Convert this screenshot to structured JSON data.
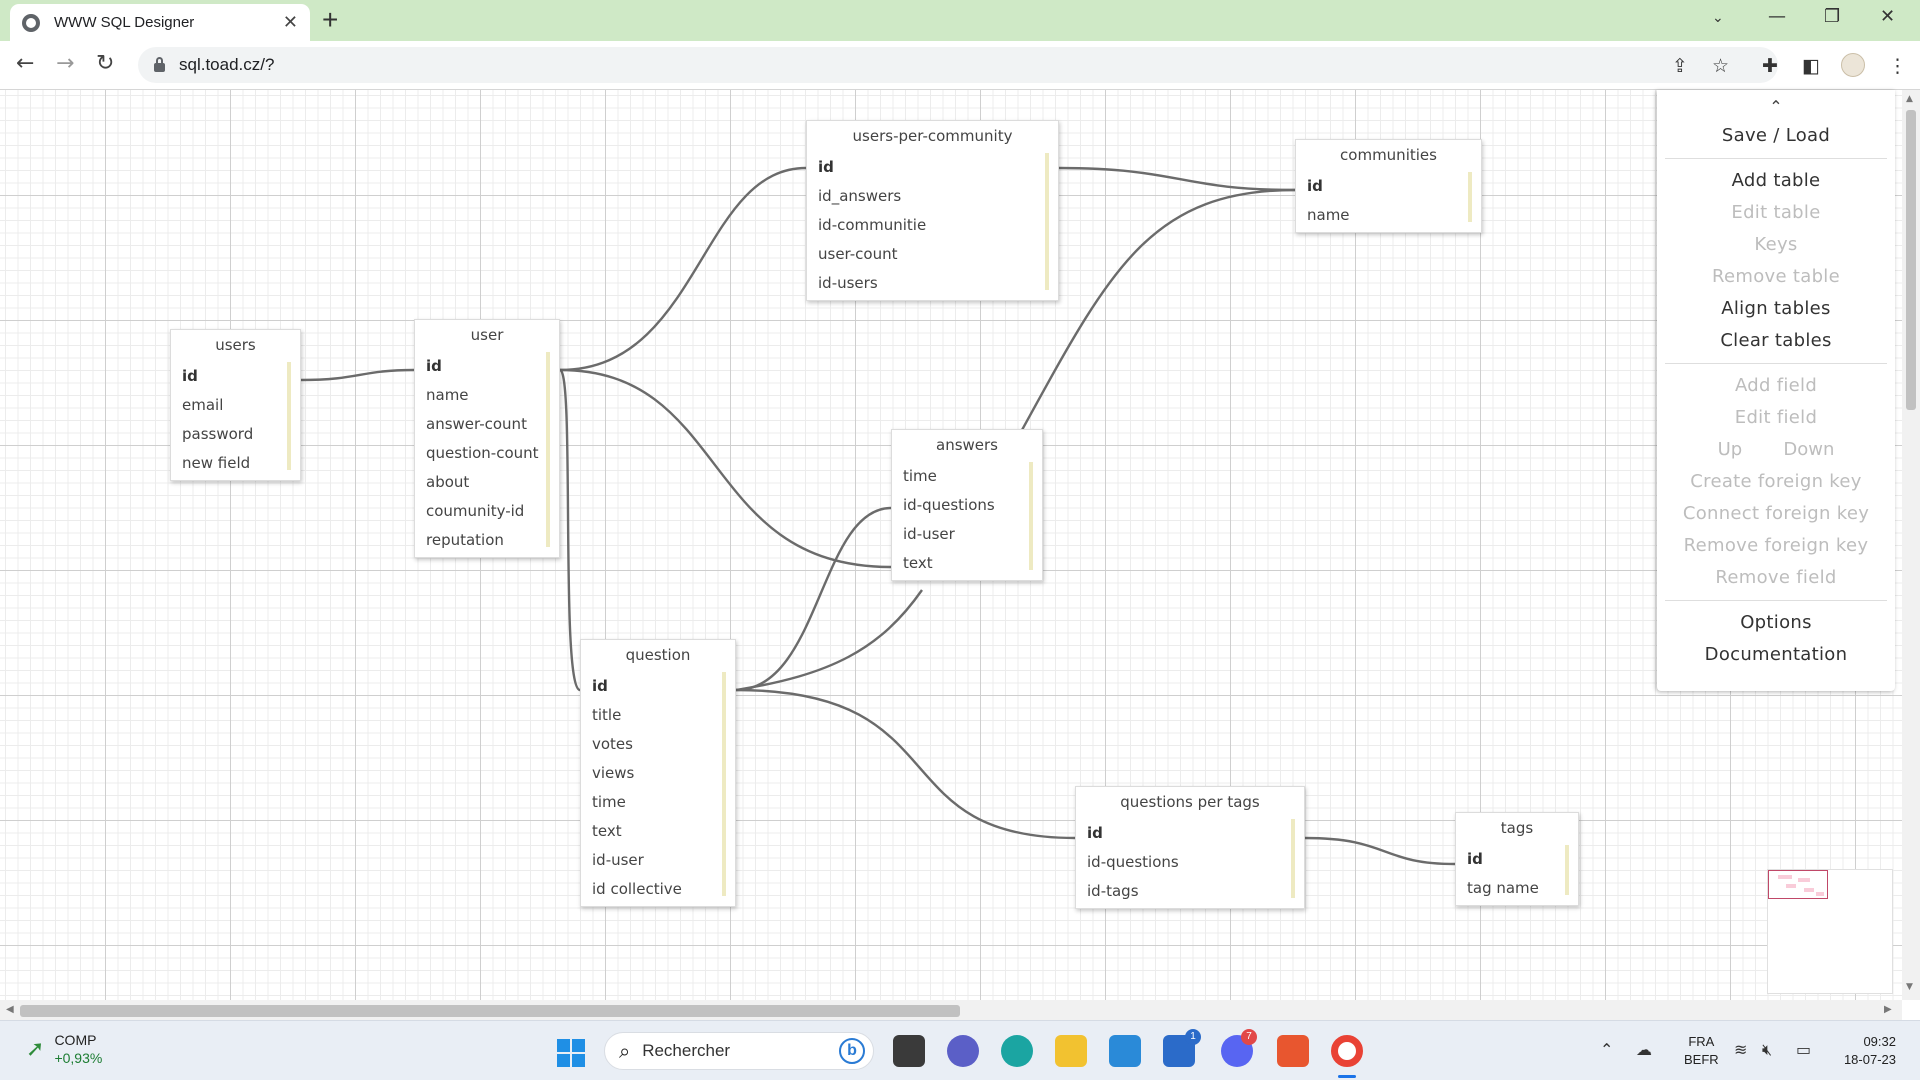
{
  "browser": {
    "tab_title": "WWW SQL Designer",
    "tab_close": "✕",
    "new_tab": "+",
    "url": "sql.toad.cz/?"
  },
  "tables": [
    {
      "name": "users",
      "fields": [
        {
          "label": "id",
          "pk": true
        },
        {
          "label": "email"
        },
        {
          "label": "password"
        },
        {
          "label": "new field"
        }
      ]
    },
    {
      "name": "user",
      "fields": [
        {
          "label": "id",
          "pk": true
        },
        {
          "label": "name"
        },
        {
          "label": "answer-count"
        },
        {
          "label": "question-count"
        },
        {
          "label": "about"
        },
        {
          "label": "coumunity-id"
        },
        {
          "label": "reputation"
        }
      ]
    },
    {
      "name": "users-per-community",
      "fields": [
        {
          "label": "id",
          "pk": true
        },
        {
          "label": "id_answers"
        },
        {
          "label": "id-communitie"
        },
        {
          "label": "user-count"
        },
        {
          "label": "id-users"
        }
      ]
    },
    {
      "name": "communities",
      "fields": [
        {
          "label": "id",
          "pk": true
        },
        {
          "label": "name"
        }
      ]
    },
    {
      "name": "answers",
      "fields": [
        {
          "label": "time"
        },
        {
          "label": "id-questions"
        },
        {
          "label": "id-user"
        },
        {
          "label": "text"
        }
      ]
    },
    {
      "name": "question",
      "fields": [
        {
          "label": "id",
          "pk": true
        },
        {
          "label": "title"
        },
        {
          "label": "votes"
        },
        {
          "label": "views"
        },
        {
          "label": "time"
        },
        {
          "label": "text"
        },
        {
          "label": "id-user"
        },
        {
          "label": "id collective"
        }
      ]
    },
    {
      "name": "questions per tags",
      "fields": [
        {
          "label": "id",
          "pk": true
        },
        {
          "label": "id-questions"
        },
        {
          "label": "id-tags"
        }
      ]
    },
    {
      "name": "tags",
      "fields": [
        {
          "label": "id",
          "pk": true
        },
        {
          "label": "tag name"
        }
      ]
    }
  ],
  "menu": {
    "collapse": "⌃",
    "save_load": "Save / Load",
    "add_table": "Add table",
    "edit_table": "Edit table",
    "keys": "Keys",
    "remove_table": "Remove table",
    "align_tables": "Align tables",
    "clear_tables": "Clear tables",
    "add_field": "Add field",
    "edit_field": "Edit field",
    "up": "Up",
    "down": "Down",
    "create_fk": "Create foreign key",
    "connect_fk": "Connect foreign key",
    "remove_fk": "Remove foreign key",
    "remove_field": "Remove field",
    "options": "Options",
    "documentation": "Documentation"
  },
  "taskbar": {
    "stock_name": "COMP",
    "stock_change": "+0,93%",
    "search_placeholder": "Rechercher",
    "bing_letter": "b",
    "store_badge": "1",
    "discord_badge": "7",
    "lang_top": "FRA",
    "lang_bottom": "BEFR",
    "time": "09:32",
    "date": "18-07-23"
  },
  "colors": {
    "tabbar": "#cfe9c6",
    "relation_line": "#6b6b6b",
    "field_marker": "#eeeac2",
    "disabled_menu": "#bdbdbd"
  }
}
